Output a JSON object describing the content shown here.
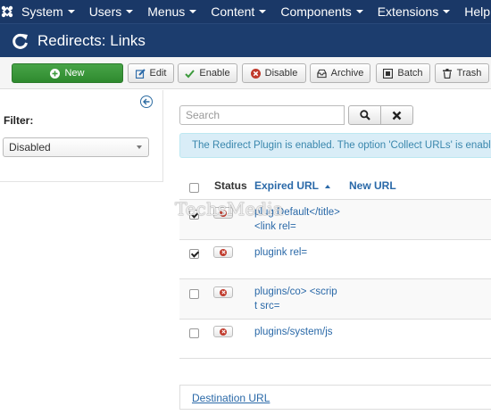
{
  "topnav": {
    "items": [
      {
        "label": "System"
      },
      {
        "label": "Users"
      },
      {
        "label": "Menus"
      },
      {
        "label": "Content"
      },
      {
        "label": "Components"
      },
      {
        "label": "Extensions"
      },
      {
        "label": "Help"
      }
    ]
  },
  "header": {
    "title": "Redirects: Links"
  },
  "toolbar": {
    "new_label": "New",
    "edit_label": "Edit",
    "enable_label": "Enable",
    "disable_label": "Disable",
    "archive_label": "Archive",
    "batch_label": "Batch",
    "trash_label": "Trash"
  },
  "sidebar": {
    "filter_label": "Filter:",
    "filter_value": "Disabled"
  },
  "search": {
    "placeholder": "Search"
  },
  "alert": {
    "text": "The Redirect Plugin is enabled. The option 'Collect URLs' is enabled."
  },
  "table": {
    "headers": {
      "status": "Status",
      "expired_url": "Expired URL",
      "new_url": "New URL"
    },
    "rows": [
      {
        "line1": "plug Default</title>",
        "line2": "<link rel=",
        "checked": true
      },
      {
        "line1": "plugink rel=",
        "line2": "",
        "checked": true
      },
      {
        "line1": "plugins/co> <scrip",
        "line2": "t src=",
        "checked": false
      },
      {
        "line1": "plugins/system/js",
        "line2": "",
        "checked": false
      }
    ]
  },
  "destination": {
    "label": "Destination URL"
  },
  "watermark": {
    "text": "TechsMedia"
  },
  "colors": {
    "nav": "#1a3867",
    "header": "#1c3d6e",
    "new_button": "#3c9a3c",
    "link": "#2a69a8",
    "alert_bg": "#d9edf7",
    "alert_text": "#3a87ad",
    "status_x": "#c0392b"
  }
}
